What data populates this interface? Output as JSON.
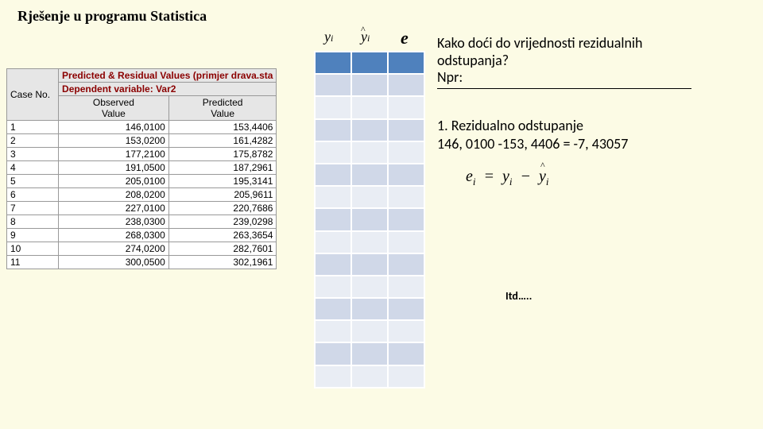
{
  "title": "Rješenje u programu Statistica",
  "symbols": {
    "y": "yᵢ",
    "yhat": "ŷᵢ",
    "e": "e"
  },
  "stat_table": {
    "header1": "Predicted & Residual Values (primjer drava.sta",
    "header2": "Dependent variable: Var2",
    "case_label": "Case No.",
    "obs_label_1": "Observed",
    "obs_label_2": "Value",
    "pred_label_1": "Predicted",
    "pred_label_2": "Value",
    "rows": [
      {
        "case": "1",
        "obs": "146,0100",
        "pred": "153,4406"
      },
      {
        "case": "2",
        "obs": "153,0200",
        "pred": "161,4282"
      },
      {
        "case": "3",
        "obs": "177,2100",
        "pred": "175,8782"
      },
      {
        "case": "4",
        "obs": "191,0500",
        "pred": "187,2961"
      },
      {
        "case": "5",
        "obs": "205,0100",
        "pred": "195,3141"
      },
      {
        "case": "6",
        "obs": "208,0200",
        "pred": "205,9611"
      },
      {
        "case": "7",
        "obs": "227,0100",
        "pred": "220,7686"
      },
      {
        "case": "8",
        "obs": "238,0300",
        "pred": "239,0298"
      },
      {
        "case": "9",
        "obs": "268,0300",
        "pred": "263,3654"
      },
      {
        "case": "10",
        "obs": "274,0200",
        "pred": "282,7601"
      },
      {
        "case": "11",
        "obs": "300,0500",
        "pred": "302,1961"
      }
    ]
  },
  "question": {
    "l1": "Kako doći do vrijednosti  rezidualnih",
    "l2": "odstupanja?",
    "l3": "Npr:"
  },
  "answer": {
    "l1": "1.   Rezidualno odstupanje",
    "l2": "146, 0100 -153, 4406 = -7, 43057"
  },
  "formula": {
    "e": "e",
    "i": "i",
    "eq": "=",
    "y": "y",
    "minus": "−",
    "yhat": "y"
  },
  "etc": "Itd…..",
  "chart_data": {
    "type": "table",
    "title": "Predicted & Residual Values (primjer drava.sta) — Dependent variable: Var2",
    "columns": [
      "Case No.",
      "Observed Value",
      "Predicted Value"
    ],
    "rows": [
      [
        1,
        146.01,
        153.4406
      ],
      [
        2,
        153.02,
        161.4282
      ],
      [
        3,
        177.21,
        175.8782
      ],
      [
        4,
        191.05,
        187.2961
      ],
      [
        5,
        205.01,
        195.3141
      ],
      [
        6,
        208.02,
        205.9611
      ],
      [
        7,
        227.01,
        220.7686
      ],
      [
        8,
        238.03,
        239.0298
      ],
      [
        9,
        268.03,
        263.3654
      ],
      [
        10,
        274.02,
        282.7601
      ],
      [
        11,
        300.05,
        302.1961
      ]
    ]
  }
}
